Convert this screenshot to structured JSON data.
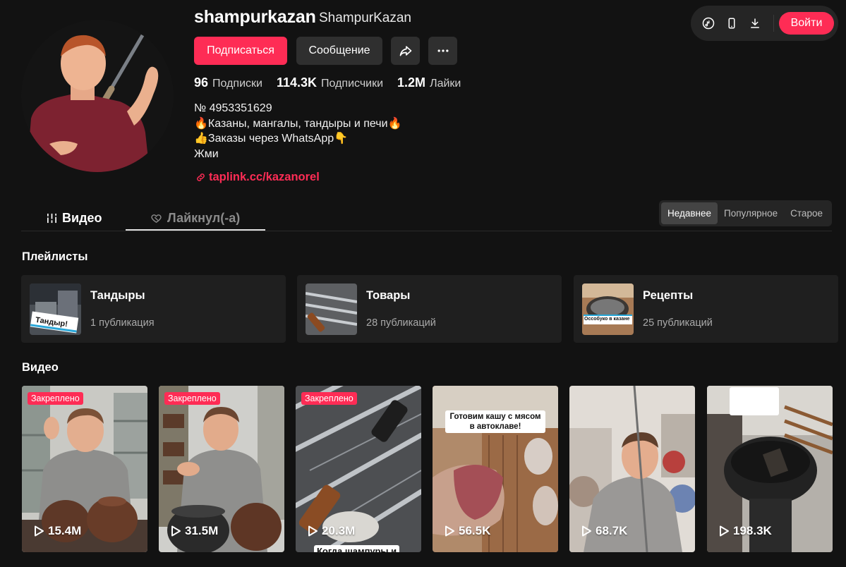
{
  "topbar": {
    "login_label": "Войти",
    "icons": [
      "tiktok-icon",
      "mobile-icon",
      "download-icon"
    ]
  },
  "profile": {
    "username": "shampurkazan",
    "nickname": "ShampurKazan",
    "follow_label": "Подписаться",
    "message_label": "Сообщение",
    "stats": [
      {
        "value": "96",
        "label": "Подписки"
      },
      {
        "value": "114.3K",
        "label": "Подписчики"
      },
      {
        "value": "1.2M",
        "label": "Лайки"
      }
    ],
    "bio": [
      "№ 4953351629",
      "🔥Казаны, мангалы, тандыры и печи🔥",
      "👍Заказы через WhatsApp👇",
      "Жми"
    ],
    "link": "taplink.cc/kazanorel"
  },
  "tabs": {
    "video": "Видео",
    "liked": "Лайкнул(-а)"
  },
  "sort": {
    "options": [
      "Недавнее",
      "Популярное",
      "Старое"
    ],
    "active": "Недавнее"
  },
  "sections": {
    "playlists": "Плейлисты",
    "videos": "Видео"
  },
  "playlists": [
    {
      "name": "Тандыры",
      "count": "1 публикация",
      "thumb_text": "Тандыр!"
    },
    {
      "name": "Товары",
      "count": "28 публикаций"
    },
    {
      "name": "Рецепты",
      "count": "25 публикаций",
      "thumb_text": "Оссобуко в казане"
    }
  ],
  "videos": [
    {
      "views": "15.4M",
      "pinned": "Закреплено"
    },
    {
      "views": "31.5M",
      "pinned": "Закреплено"
    },
    {
      "views": "20.3M",
      "pinned": "Закреплено",
      "caption": "Когда шампуры и"
    },
    {
      "views": "56.5K",
      "caption": "Готовим кашу с мясом в автоклаве!"
    },
    {
      "views": "68.7K"
    },
    {
      "views": "198.3K"
    }
  ],
  "colors": {
    "accent": "#fe2c55",
    "background": "#121212"
  }
}
